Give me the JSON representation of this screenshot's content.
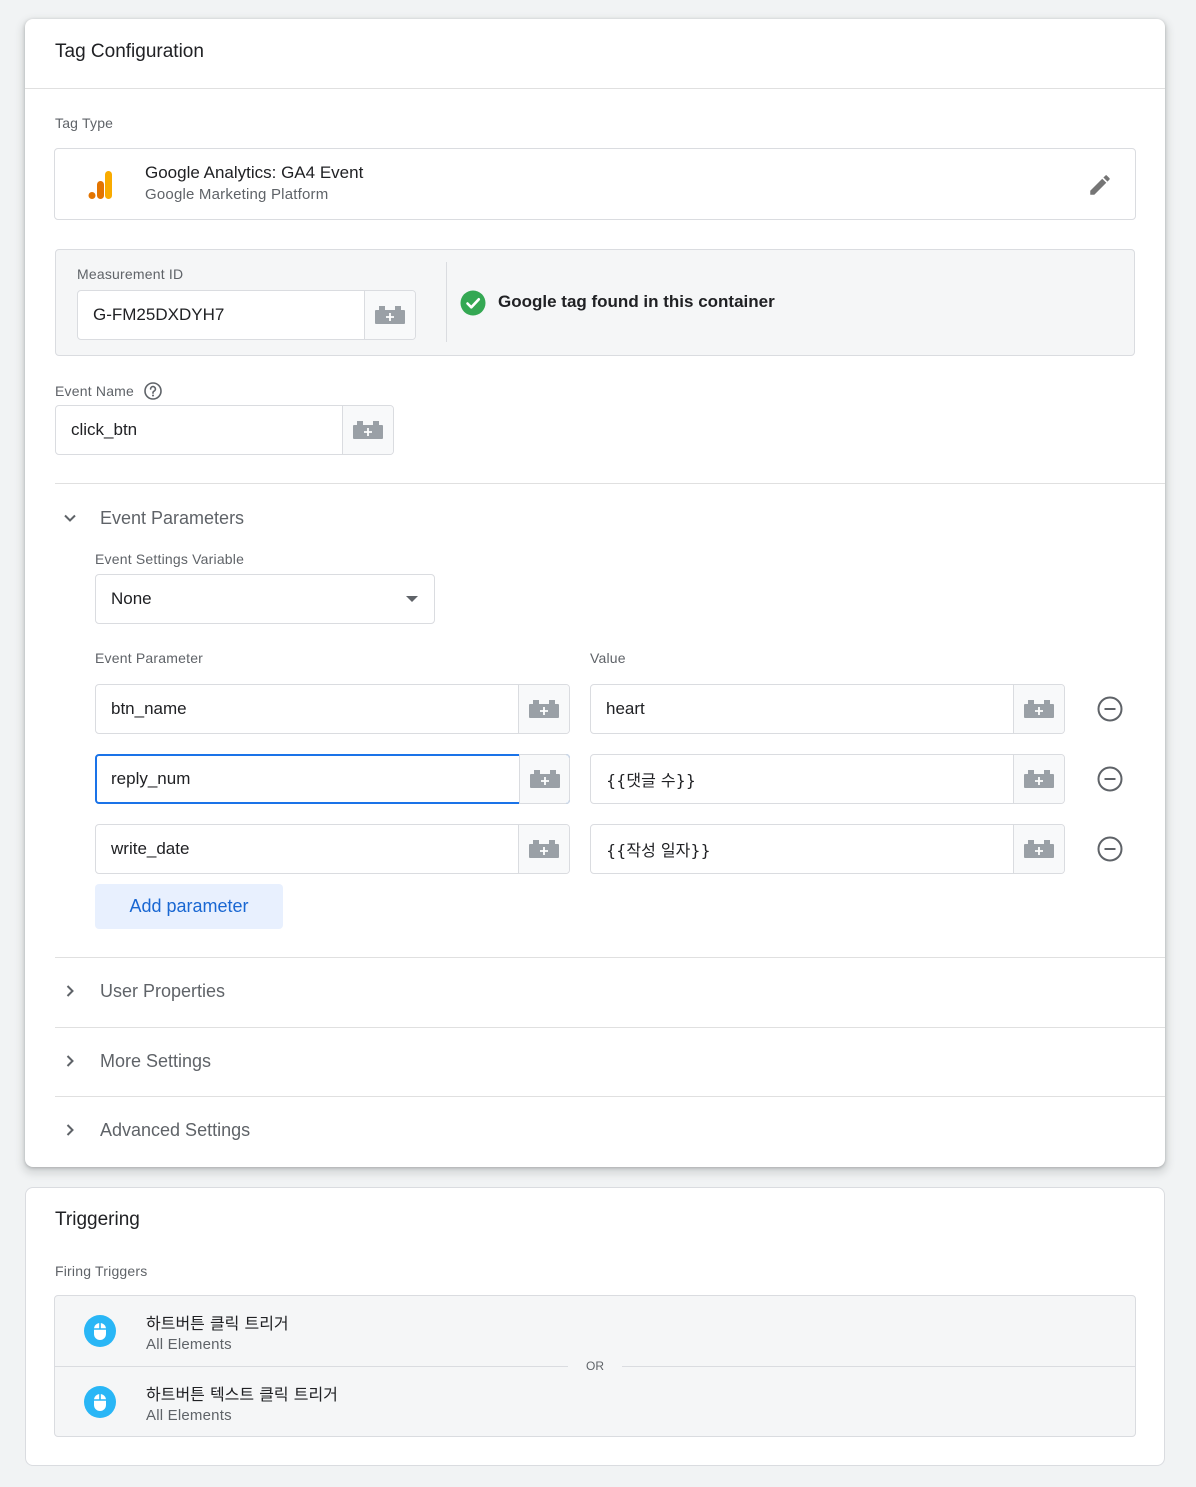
{
  "tag_config": {
    "title": "Tag Configuration",
    "tag_type_label": "Tag Type",
    "tag_type": {
      "name": "Google Analytics: GA4 Event",
      "sub": "Google Marketing Platform"
    },
    "measurement_id_label": "Measurement ID",
    "measurement_id": "G-FM25DXDYH7",
    "google_tag_status": "Google tag found in this container",
    "event_name_label": "Event Name",
    "event_name": "click_btn",
    "event_parameters": {
      "title": "Event Parameters",
      "settings_variable_label": "Event Settings Variable",
      "settings_variable": "None",
      "col_param": "Event Parameter",
      "col_value": "Value",
      "rows": [
        {
          "param": "btn_name",
          "value": "heart"
        },
        {
          "param": "reply_num",
          "value": "{{댓글 수}}"
        },
        {
          "param": "write_date",
          "value": "{{작성 일자}}"
        }
      ],
      "add_label": "Add parameter"
    },
    "sections": [
      "User Properties",
      "More Settings",
      "Advanced Settings"
    ]
  },
  "triggering": {
    "title": "Triggering",
    "firing_label": "Firing Triggers",
    "or_label": "OR",
    "triggers": [
      {
        "name": "하트버튼 클릭 트리거",
        "sub": "All Elements"
      },
      {
        "name": "하트버튼 텍스트 클릭 트리거",
        "sub": "All Elements"
      }
    ]
  },
  "colors": {
    "accent": "#1a73e8",
    "success": "#34a853",
    "trigger_icon": "#29b6f6",
    "ga_orange": "#f9ab00",
    "ga_dark_orange": "#e37400"
  }
}
